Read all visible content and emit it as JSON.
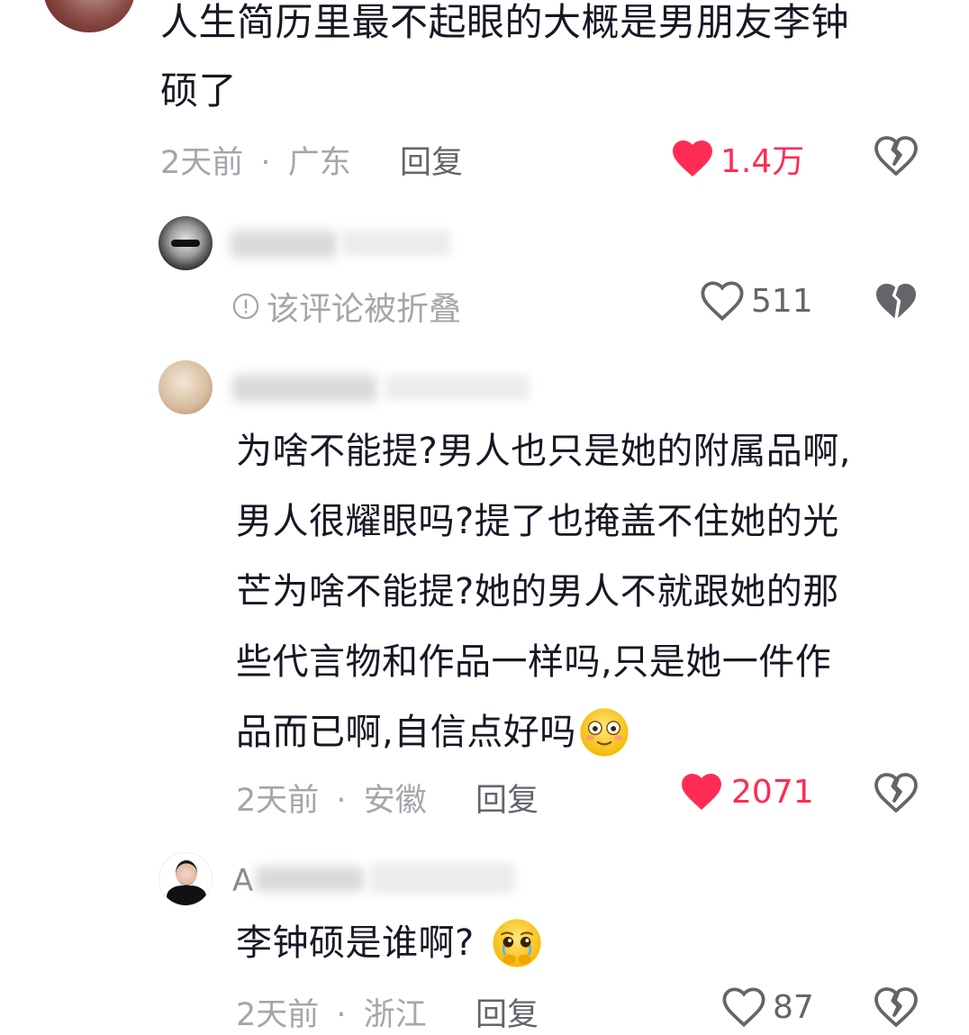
{
  "top_comment": {
    "text_line1": "人生简历里最不起眼的大概是男朋友李钟",
    "text_line2": "硕了",
    "time": "2天前",
    "location": "广东",
    "separator": "·",
    "reply_label": "回复",
    "likes": "1.4万",
    "liked": true
  },
  "reply1": {
    "folded_text": "该评论被折叠",
    "likes": "511",
    "liked": false
  },
  "reply2": {
    "lines": [
      "为啥不能提?男人也只是她的附属品啊,",
      "男人很耀眼吗?提了也掩盖不住她的光",
      "芒为啥不能提?她的男人不就跟她的那",
      "些代言物和作品一样吗,只是她一件作",
      "品而已啊,自信点好吗"
    ],
    "emoji": "😳",
    "time": "2天前",
    "location": "安徽",
    "separator": "·",
    "reply_label": "回复",
    "likes": "2071",
    "liked": true
  },
  "reply3": {
    "username_initial": "A",
    "text": "李钟硕是谁啊?",
    "emoji": "🥹",
    "time": "2天前",
    "location": "浙江",
    "separator": "·",
    "reply_label": "回复",
    "likes": "87",
    "liked": false
  },
  "colors": {
    "like_active": "#fe2c55",
    "meta_grey": "#a4a6ab",
    "icon_grey": "#63656b"
  },
  "icons": [
    "heart-filled-icon",
    "heart-outline-icon",
    "broken-heart-icon",
    "info-circle-icon"
  ]
}
